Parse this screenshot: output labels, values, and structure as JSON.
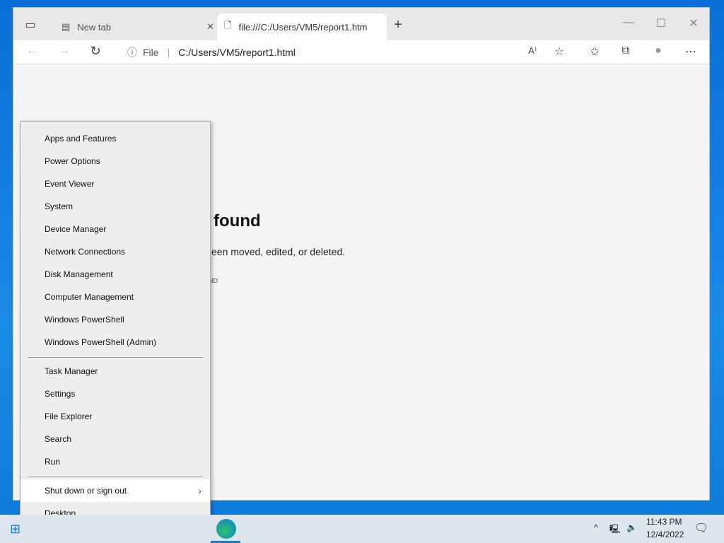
{
  "browser": {
    "tabs": [
      {
        "label": "New tab",
        "icon": "new-tab-icon"
      },
      {
        "label": "file:///C:/Users/VM5/report1.htm",
        "icon": "file-error-icon"
      }
    ],
    "address": {
      "scheme_label": "File",
      "url": "C:/Users/VM5/report1.html"
    }
  },
  "page": {
    "heading": "found",
    "message": "een moved, edited, or deleted.",
    "error_code": "ND"
  },
  "menu": {
    "group1": [
      "Apps and Features",
      "Power Options",
      "Event Viewer",
      "System",
      "Device Manager",
      "Network Connections",
      "Disk Management",
      "Computer Management",
      "Windows PowerShell",
      "Windows PowerShell (Admin)"
    ],
    "group2": [
      "Task Manager",
      "Settings",
      "File Explorer",
      "Search",
      "Run"
    ],
    "group3": [
      "Shut down or sign out",
      "Desktop"
    ]
  },
  "taskbar": {
    "time": "11:43 PM",
    "date": "12/4/2022"
  }
}
